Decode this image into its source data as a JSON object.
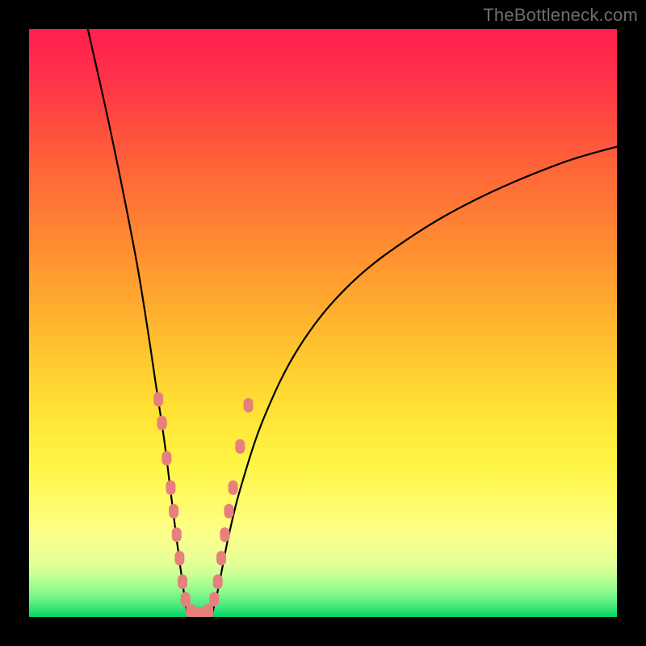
{
  "watermark": "TheBottleneck.com",
  "chart_data": {
    "type": "line",
    "title": "",
    "xlabel": "",
    "ylabel": "",
    "xlim": [
      0,
      100
    ],
    "ylim": [
      0,
      100
    ],
    "grid": false,
    "legend": false,
    "annotations": [],
    "series": [
      {
        "name": "curve-left",
        "x": [
          10,
          14,
          18,
          20,
          21.5,
          23,
          24,
          25,
          25.8,
          26.5,
          27
        ],
        "y": [
          100,
          82,
          62,
          50,
          40,
          30,
          22,
          14,
          8,
          3,
          0
        ]
      },
      {
        "name": "curve-right",
        "x": [
          31,
          32,
          33,
          34,
          36,
          40,
          46,
          54,
          64,
          76,
          90,
          100
        ],
        "y": [
          0,
          4,
          9,
          14,
          22,
          34,
          46,
          56,
          64,
          71,
          77,
          80
        ]
      },
      {
        "name": "valley-floor",
        "x": [
          27,
          31
        ],
        "y": [
          0,
          0
        ]
      }
    ],
    "markers": {
      "name": "sample-points",
      "color": "#e77f7d",
      "points": [
        {
          "x": 22.0,
          "y": 37
        },
        {
          "x": 22.6,
          "y": 33
        },
        {
          "x": 23.4,
          "y": 27
        },
        {
          "x": 24.1,
          "y": 22
        },
        {
          "x": 24.6,
          "y": 18
        },
        {
          "x": 25.1,
          "y": 14
        },
        {
          "x": 25.6,
          "y": 10
        },
        {
          "x": 26.1,
          "y": 6
        },
        {
          "x": 26.6,
          "y": 3
        },
        {
          "x": 27.5,
          "y": 1
        },
        {
          "x": 28.5,
          "y": 0.5
        },
        {
          "x": 29.5,
          "y": 0.5
        },
        {
          "x": 30.5,
          "y": 1
        },
        {
          "x": 31.5,
          "y": 3
        },
        {
          "x": 32.1,
          "y": 6
        },
        {
          "x": 32.7,
          "y": 10
        },
        {
          "x": 33.3,
          "y": 14
        },
        {
          "x": 34.0,
          "y": 18
        },
        {
          "x": 34.7,
          "y": 22
        },
        {
          "x": 35.9,
          "y": 29
        },
        {
          "x": 37.3,
          "y": 36
        }
      ]
    },
    "gradient_bands": [
      {
        "y": 0.0,
        "color": "#ff1f4f"
      },
      {
        "y": 0.08,
        "color": "#ff3149"
      },
      {
        "y": 0.16,
        "color": "#ff4b3f"
      },
      {
        "y": 0.24,
        "color": "#ff6638"
      },
      {
        "y": 0.34,
        "color": "#ff8433"
      },
      {
        "y": 0.44,
        "color": "#ffa22f"
      },
      {
        "y": 0.54,
        "color": "#ffc22f"
      },
      {
        "y": 0.64,
        "color": "#ffe033"
      },
      {
        "y": 0.74,
        "color": "#fff545"
      },
      {
        "y": 0.8,
        "color": "#fffb66"
      },
      {
        "y": 0.85,
        "color": "#fdff84"
      },
      {
        "y": 0.88,
        "color": "#f3ff90"
      },
      {
        "y": 0.905,
        "color": "#e6ff96"
      },
      {
        "y": 0.925,
        "color": "#ceff96"
      },
      {
        "y": 0.94,
        "color": "#b1fe93"
      },
      {
        "y": 0.955,
        "color": "#8ffa8d"
      },
      {
        "y": 0.97,
        "color": "#6af385"
      },
      {
        "y": 0.983,
        "color": "#41e879"
      },
      {
        "y": 0.993,
        "color": "#1bdc6e"
      },
      {
        "y": 1.0,
        "color": "#07d366"
      }
    ]
  }
}
